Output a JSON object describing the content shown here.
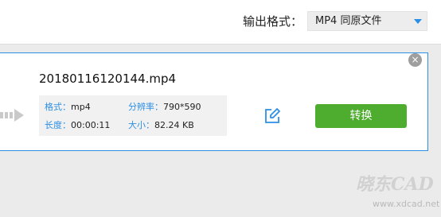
{
  "header": {
    "format_label": "输出格式：",
    "format_value": "MP4  同原文件"
  },
  "task": {
    "filename": "20180116120144.mp4",
    "info": {
      "format_key": "格式：",
      "format_val": "mp4",
      "resolution_key": "分辨率：",
      "resolution_val": "790*590",
      "duration_key": "长度：",
      "duration_val": "00:00:11",
      "size_key": "大小：",
      "size_val": "82.24 KB"
    },
    "close_glyph": "×",
    "convert_label": "转换"
  },
  "watermark": {
    "logo_text": "晓东CAD",
    "url": "www.xdcad.net"
  },
  "colors": {
    "accent": "#2d8fe6",
    "convert_green": "#4eac2f",
    "background": "#ebebeb"
  },
  "icons": {
    "close": "close-icon",
    "edit": "edit-icon",
    "arrow": "arrow-right-icon",
    "dropdown": "caret-down-icon"
  }
}
